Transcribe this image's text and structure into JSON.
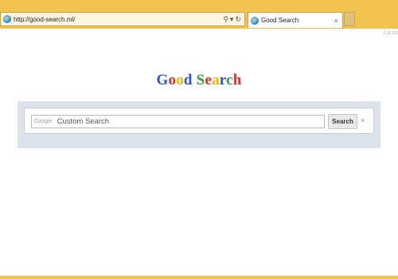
{
  "browser": {
    "address_url": "http://good-search.ml/",
    "tab_title": "Good Search",
    "tab_close": "×",
    "search_tool": "⚲",
    "dropdown_tool": "▾",
    "refresh_tool": "↻"
  },
  "page": {
    "license_text": "Licen",
    "logo": {
      "letters": [
        {
          "char": "G",
          "color": "#2a55c8"
        },
        {
          "char": "o",
          "color": "#d93025"
        },
        {
          "char": "o",
          "color": "#f2b600"
        },
        {
          "char": "d",
          "color": "#2a55c8"
        },
        {
          "char": " ",
          "color": "#000000"
        },
        {
          "char": "S",
          "color": "#2f9e44"
        },
        {
          "char": "e",
          "color": "#d93025"
        },
        {
          "char": "a",
          "color": "#f2b600"
        },
        {
          "char": "r",
          "color": "#2a55c8"
        },
        {
          "char": "c",
          "color": "#2f9e44"
        },
        {
          "char": "h",
          "color": "#d93025"
        }
      ]
    },
    "search": {
      "brand_mark": "Google",
      "placeholder": "Custom Search",
      "button_label": "Search",
      "clear_label": "×"
    }
  }
}
